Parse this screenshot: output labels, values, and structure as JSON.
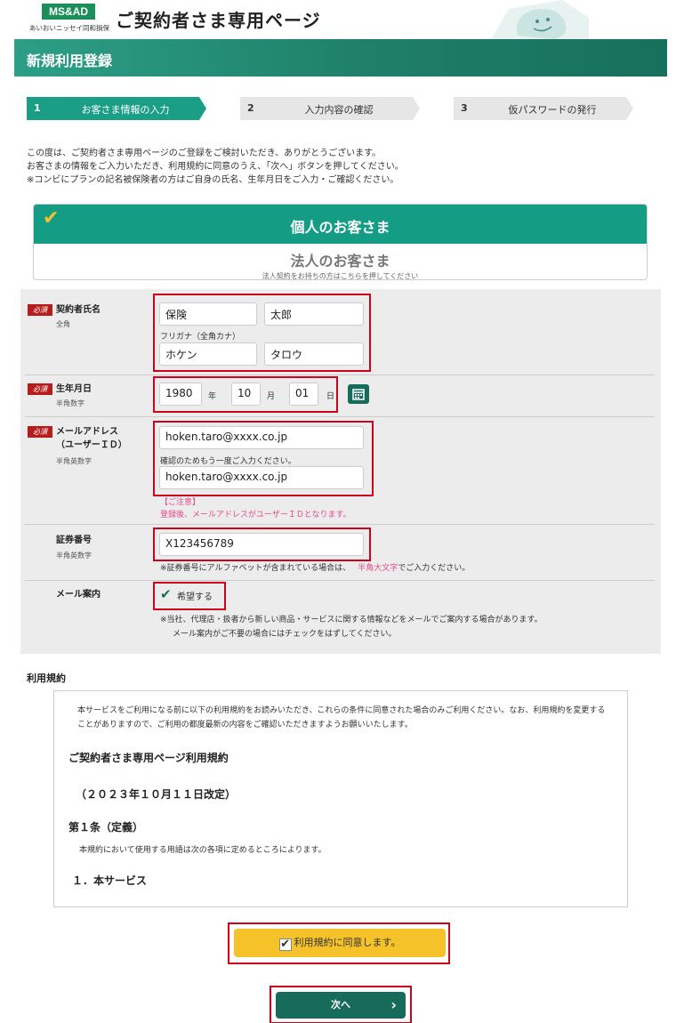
{
  "header": {
    "logo_text": "MS&AD",
    "logo_sub": "あいおいニッセイ同和損保",
    "site_title": "ご契約者さま専用ページ"
  },
  "page_title": "新規利用登録",
  "steps": [
    {
      "num": "1",
      "label": "お客さま情報の入力"
    },
    {
      "num": "2",
      "label": "入力内容の確認"
    },
    {
      "num": "3",
      "label": "仮パスワードの発行"
    }
  ],
  "intro": {
    "line1": "この度は、ご契約者さま専用ページのご登録をご検討いただき、ありがとうございます。",
    "line2": "お客さまの情報をご入力いただき、利用規約に同意のうえ、「次へ」ボタンを押してください。",
    "line3": "※コンビにプランの記名被保険者の方はご自身の氏名、生年月日をご入力・ご確認ください。"
  },
  "customer_type": {
    "personal": "個人のお客さま",
    "corporate": "法人のお客さま",
    "corporate_sub": "法人契約をお持ちの方はこちらを押してください"
  },
  "form": {
    "required_badge": "必須",
    "name": {
      "label": "契約者氏名",
      "sub": "全角",
      "last": "保険",
      "first": "太郎",
      "kana_label": "フリガナ（全角カナ）",
      "kana_last": "ホケン",
      "kana_first": "タロウ"
    },
    "birth": {
      "label": "生年月日",
      "sub": "半角数字",
      "year": "1980",
      "year_unit": "年",
      "month": "10",
      "month_unit": "月",
      "day": "01",
      "day_unit": "日"
    },
    "email": {
      "label1": "メールアドレス",
      "label2": "（ユーザーＩＤ）",
      "sub": "半角英数字",
      "value": "hoken.taro@xxxx.co.jp",
      "confirm_hint": "確認のためもう一度ご入力ください。",
      "confirm_value": "hoken.taro@xxxx.co.jp",
      "note_title": "【ご注意】",
      "note": "登録後、メールアドレスがユーザーＩＤとなります。"
    },
    "policy": {
      "label": "証券番号",
      "sub": "半角英数字",
      "value": "X123456789",
      "hint_a": "※証券番号にアルファベットが含まれている場合は、",
      "hint_b": "半角大文字",
      "hint_c": "でご入力ください。"
    },
    "mail": {
      "label": "メール案内",
      "checkbox": "希望する",
      "note1": "※当社、代理店・扱者から新しい商品・サービスに関する情報などをメールでご案内する場合があります。",
      "note2": "メール案内がご不要の場合にはチェックをはずしてください。"
    }
  },
  "terms": {
    "section_title": "利用規約",
    "intro": "本サービスをご利用になる前に以下の利用規約をお読みいただき、これらの条件に同意された場合のみご利用ください。なお、利用規約を変更することがありますので、ご利用の都度最新の内容をご確認いただきますようお願いいたします。",
    "title": "ご契約者さま専用ページ利用規約",
    "revision": "（２０２３年１０月１１日改定）",
    "article1": "第１条（定義）",
    "article1_text": "本規約において使用する用語は次の各項に定めるところによります。",
    "item1": "１．本サービス"
  },
  "buttons": {
    "agree": "利用規約に同意します。",
    "next": "次へ"
  }
}
